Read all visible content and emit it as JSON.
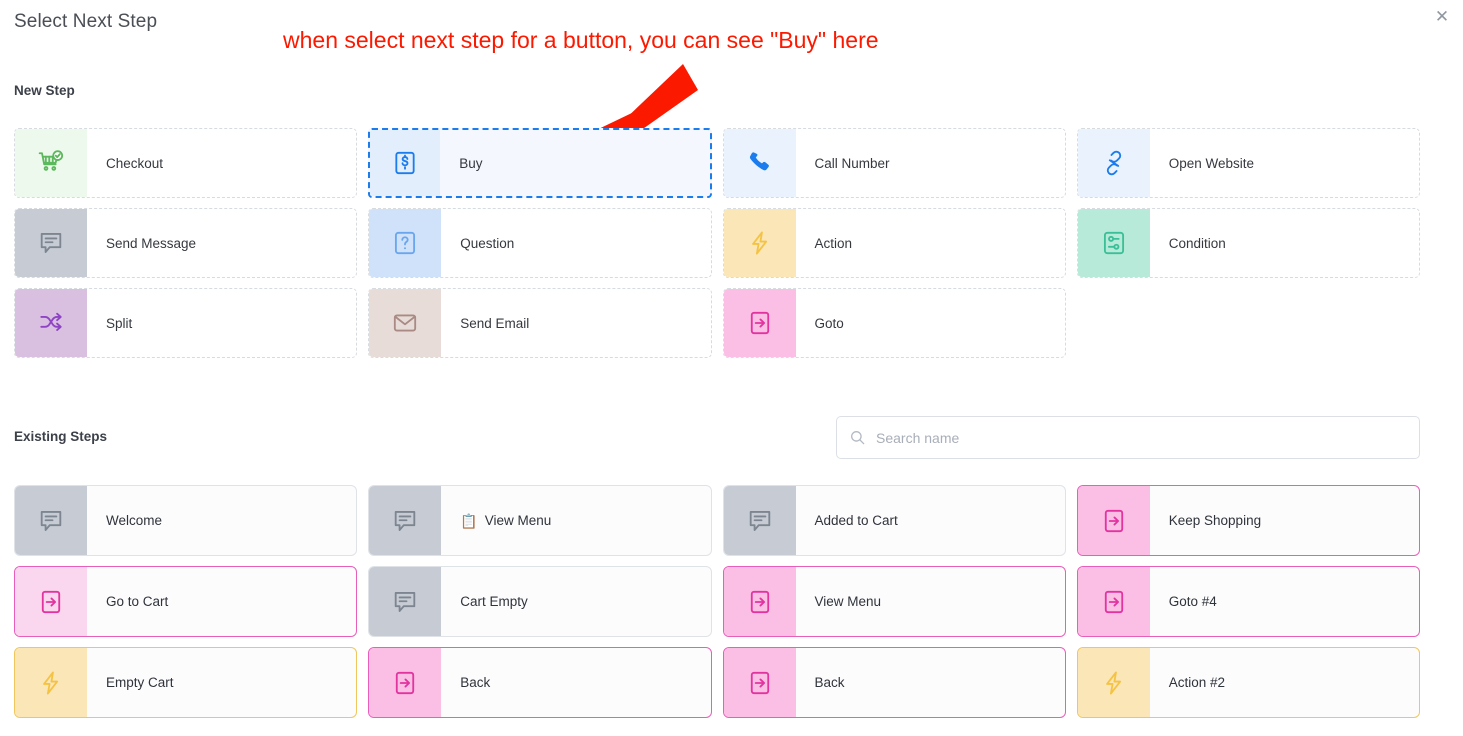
{
  "dialog": {
    "title": "Select Next Step",
    "close_label": "✕"
  },
  "annotation": {
    "text": "when select next step for a button, you can see \"Buy\" here",
    "color": "#fb1900",
    "arrow": "red-arrow-pointing-to-buy-card"
  },
  "new_step": {
    "label": "New Step",
    "items": [
      {
        "label": "Checkout",
        "icon": "shopping-cart-check-icon",
        "icon_bg": "#eef9ee",
        "icon_color": "#5cb85c",
        "selected": false
      },
      {
        "label": "Buy",
        "icon": "dollar-bill-icon",
        "icon_bg": "#e3eefc",
        "icon_color": "#1b7ced",
        "selected": true
      },
      {
        "label": "Call Number",
        "icon": "phone-icon",
        "icon_bg": "#e9f2fd",
        "icon_color": "#1b7ced",
        "selected": false
      },
      {
        "label": "Open Website",
        "icon": "link-chain-icon",
        "icon_bg": "#e9f2fd",
        "icon_color": "#1b7ced",
        "selected": false
      },
      {
        "label": "Send Message",
        "icon": "chat-bubble-lines-icon",
        "icon_bg": "#c7ccd4",
        "icon_color": "#7d8590",
        "selected": false
      },
      {
        "label": "Question",
        "icon": "question-box-icon",
        "icon_bg": "#cfe2f9",
        "icon_color": "#6aa6ee",
        "selected": false
      },
      {
        "label": "Action",
        "icon": "lightning-bolt-icon",
        "icon_bg": "#fbe6b8",
        "icon_color": "#f6c council",
        "selected": false
      },
      {
        "label": "Condition",
        "icon": "sliders-box-icon",
        "icon_bg": "#b7ead9",
        "icon_color": "#3bbf97",
        "selected": false
      },
      {
        "label": "Split",
        "icon": "shuffle-arrows-icon",
        "icon_bg": "#d9bfe0",
        "icon_color": "#8e44c4",
        "selected": false
      },
      {
        "label": "Send Email",
        "icon": "envelope-icon",
        "icon_bg": "#e8dcd9",
        "icon_color": "#a98a84",
        "selected": false
      },
      {
        "label": "Goto",
        "icon": "arrow-into-box-icon",
        "icon_bg": "#fbbfe6",
        "icon_color": "#e2349f",
        "selected": false
      }
    ]
  },
  "existing_steps": {
    "label": "Existing Steps",
    "search": {
      "placeholder": "Search name",
      "value": "",
      "icon": "search-icon"
    },
    "items": [
      {
        "label": "Welcome",
        "emoji": "",
        "icon": "chat-bubble-lines-icon",
        "icon_bg": "#c7ccd4",
        "icon_color": "#7d8590",
        "border": "#dfe3e8"
      },
      {
        "label": "View Menu",
        "emoji": "📋",
        "icon": "chat-bubble-lines-icon",
        "icon_bg": "#c7ccd4",
        "icon_color": "#7d8590",
        "border": "#dfe3e8"
      },
      {
        "label": "Added to Cart",
        "emoji": "",
        "icon": "chat-bubble-lines-icon",
        "icon_bg": "#c7ccd4",
        "icon_color": "#7d8590",
        "border": "#dfe3e8"
      },
      {
        "label": "Keep Shopping",
        "emoji": "",
        "icon": "arrow-into-box-icon",
        "icon_bg": "#fbbfe6",
        "icon_color": "#e2349f",
        "border": "#e85fba"
      },
      {
        "label": "Go to Cart",
        "emoji": "",
        "icon": "arrow-into-box-icon",
        "icon_bg": "#fbd6ef",
        "icon_color": "#e2349f",
        "border": "#e85fba"
      },
      {
        "label": "Cart Empty",
        "emoji": "",
        "icon": "chat-bubble-lines-icon",
        "icon_bg": "#c7ccd4",
        "icon_color": "#7d8590",
        "border": "#dfe3e8"
      },
      {
        "label": "View Menu",
        "emoji": "",
        "icon": "arrow-into-box-icon",
        "icon_bg": "#fbbfe6",
        "icon_color": "#e2349f",
        "border": "#e85fba"
      },
      {
        "label": "Goto #4",
        "emoji": "",
        "icon": "arrow-into-box-icon",
        "icon_bg": "#fbbfe6",
        "icon_color": "#e2349f",
        "border": "#e85fba"
      },
      {
        "label": "Empty Cart",
        "emoji": "",
        "icon": "lightning-bolt-icon",
        "icon_bg": "#fbe6b8",
        "icon_color": "#f5c344",
        "border": "#efc75e"
      },
      {
        "label": "Back",
        "emoji": "",
        "icon": "arrow-into-box-icon",
        "icon_bg": "#fbbfe6",
        "icon_color": "#e2349f",
        "border": "#e85fba"
      },
      {
        "label": "Back",
        "emoji": "",
        "icon": "arrow-into-box-icon",
        "icon_bg": "#fbbfe6",
        "icon_color": "#e2349f",
        "border": "#e85fba"
      },
      {
        "label": "Action #2",
        "emoji": "",
        "icon": "lightning-bolt-icon",
        "icon_bg": "#fbe6b8",
        "icon_color": "#f5c344",
        "border": "#efc75e"
      }
    ]
  }
}
